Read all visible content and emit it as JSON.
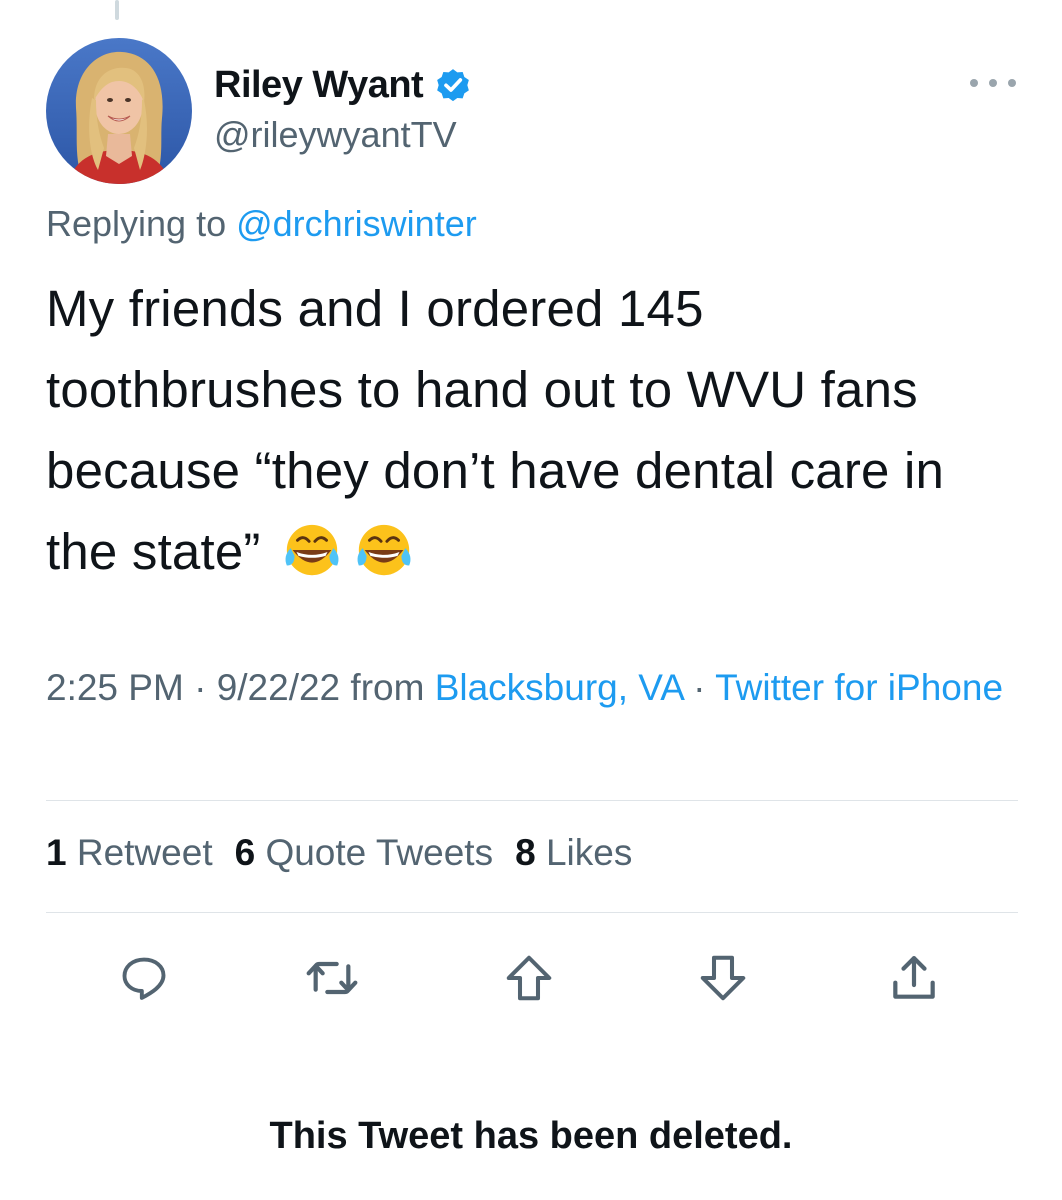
{
  "author": {
    "display_name": "Riley Wyant",
    "handle": "@rileywyantTV",
    "verified": true
  },
  "reply": {
    "prefix": "Replying to ",
    "mention": "@drchriswinter"
  },
  "tweet": {
    "text": "My friends and I ordered 145 toothbrushes to hand out to WVU fans because “they don’t have dental care in the state” ",
    "emojis": [
      "face-with-tears-of-joy",
      "face-with-tears-of-joy"
    ]
  },
  "meta": {
    "time": "2:25 PM",
    "date": "9/22/22",
    "from_label": "from",
    "location": "Blacksburg, VA",
    "separator": "·",
    "source": "Twitter for iPhone"
  },
  "stats": {
    "retweets_count": "1",
    "retweets_label": "Retweet",
    "quotes_count": "6",
    "quotes_label": "Quote Tweets",
    "likes_count": "8",
    "likes_label": "Likes"
  },
  "actions": {
    "icons": [
      "reply-icon",
      "retweet-icon",
      "upvote-icon",
      "downvote-icon",
      "share-icon"
    ]
  },
  "notice": {
    "deleted_text": "This Tweet has been deleted."
  },
  "colors": {
    "link": "#1d9bf0",
    "text": "#0f1419",
    "secondary": "#536471"
  }
}
